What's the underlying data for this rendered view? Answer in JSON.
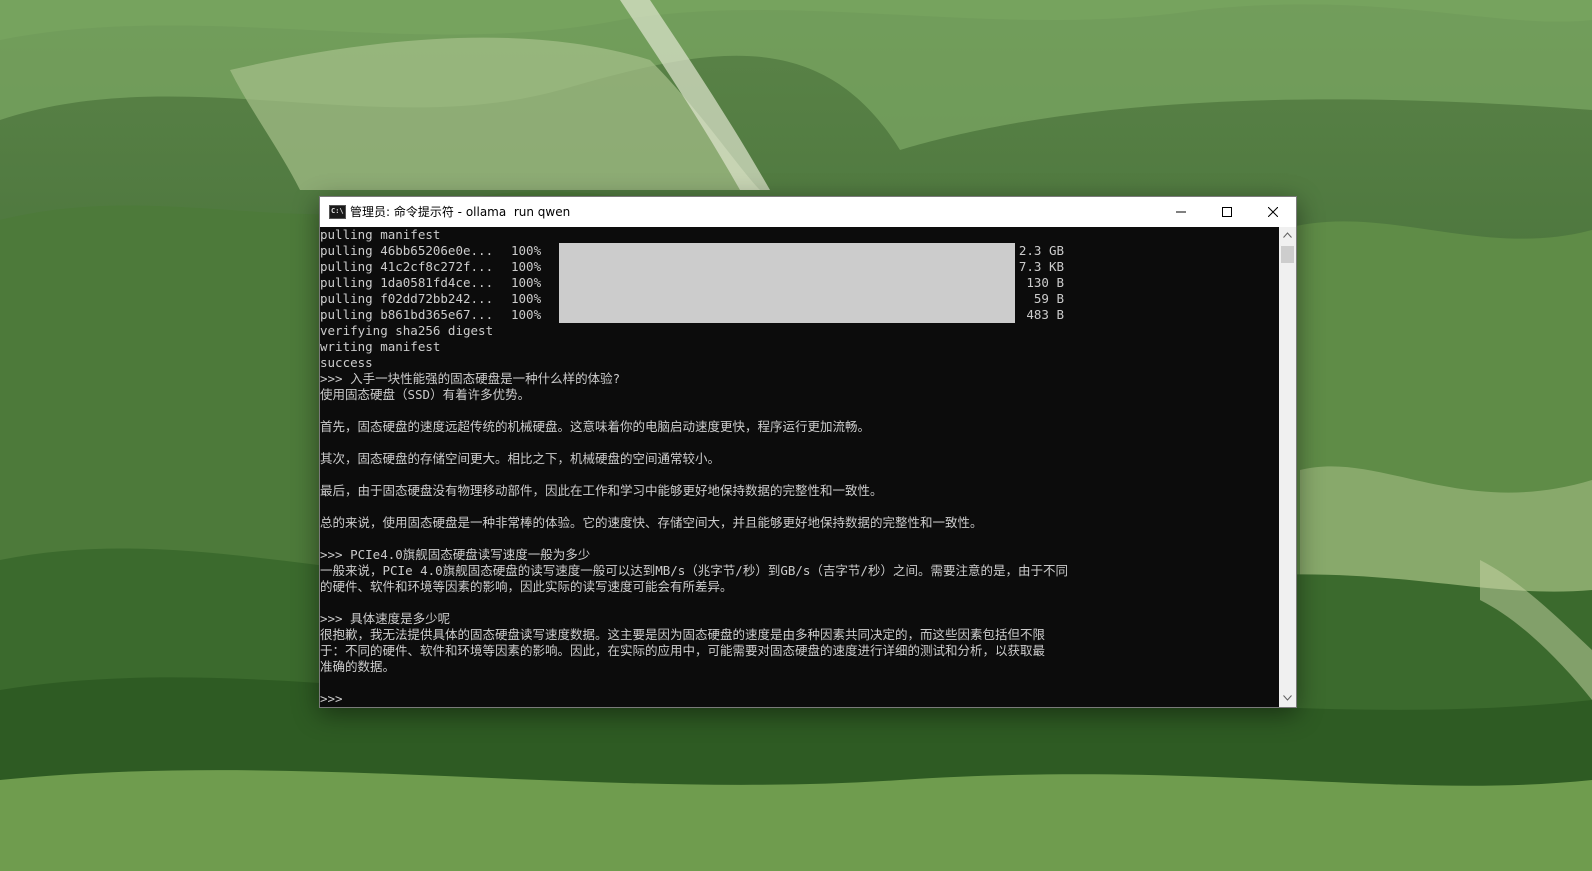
{
  "window": {
    "title": "管理员: 命令提示符 - ollama  run qwen",
    "icon": "cmd-icon",
    "icon_text": "C:\\",
    "controls": {
      "minimize": "minimize-icon",
      "maximize": "maximize-icon",
      "close": "close-icon"
    }
  },
  "console": {
    "line_manifest": "pulling manifest",
    "pulls": [
      {
        "id": "pulling 46bb65206e0e...",
        "percent": "100%",
        "progress": 1.0,
        "size": "2.3 GB"
      },
      {
        "id": "pulling 41c2cf8c272f...",
        "percent": "100%",
        "progress": 1.0,
        "size": "7.3 KB"
      },
      {
        "id": "pulling 1da0581fd4ce...",
        "percent": "100%",
        "progress": 1.0,
        "size": "130 B"
      },
      {
        "id": "pulling f02dd72bb242...",
        "percent": "100%",
        "progress": 1.0,
        "size": "59 B"
      },
      {
        "id": "pulling b861bd365e67...",
        "percent": "100%",
        "progress": 1.0,
        "size": "483 B"
      }
    ],
    "line_verify": "verifying sha256 digest",
    "line_write": "writing manifest",
    "line_success": "success",
    "q1": ">>> 入手一块性能强的固态硬盘是一种什么样的体验?",
    "a1_1": "使用固态硬盘（SSD）有着许多优势。",
    "a1_2": "首先，固态硬盘的速度远超传统的机械硬盘。这意味着你的电脑启动速度更快，程序运行更加流畅。",
    "a1_3": "其次，固态硬盘的存储空间更大。相比之下，机械硬盘的空间通常较小。",
    "a1_4": "最后，由于固态硬盘没有物理移动部件，因此在工作和学习中能够更好地保持数据的完整性和一致性。",
    "a1_5": "总的来说，使用固态硬盘是一种非常棒的体验。它的速度快、存储空间大，并且能够更好地保持数据的完整性和一致性。",
    "q2": ">>> PCIe4.0旗舰固态硬盘读写速度一般为多少",
    "a2_1": "一般来说，PCIe 4.0旗舰固态硬盘的读写速度一般可以达到MB/s（兆字节/秒）到GB/s（吉字节/秒）之间。需要注意的是，由于不同",
    "a2_2": "的硬件、软件和环境等因素的影响，因此实际的读写速度可能会有所差异。",
    "q3": ">>> 具体速度是多少呢",
    "a3_1": "很抱歉，我无法提供具体的固态硬盘读写速度数据。这主要是因为固态硬盘的速度是由多种因素共同决定的，而这些因素包括但不限",
    "a3_2": "于：不同的硬件、软件和环境等因素的影响。因此，在实际的应用中，可能需要对固态硬盘的速度进行详细的测试和分析，以获取最",
    "a3_3": "准确的数据。",
    "prompt": ">>> "
  },
  "colors": {
    "console_bg": "#0c0c0c",
    "console_fg": "#cccccc",
    "titlebar_bg": "#ffffff",
    "scrollbar_bg": "#f0f0f0"
  }
}
